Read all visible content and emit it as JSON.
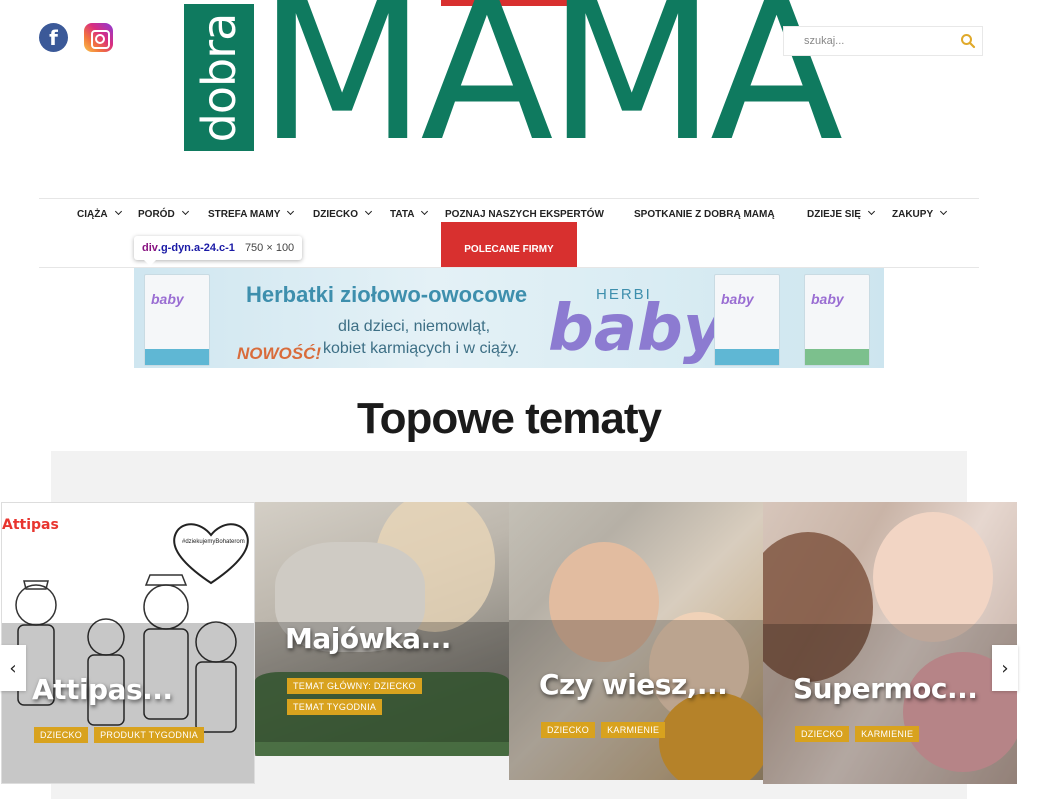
{
  "social": {
    "facebook_icon": "facebook-icon",
    "instagram_icon": "instagram-icon"
  },
  "logo": {
    "prefix": "dobra",
    "main": "MAMA"
  },
  "search": {
    "placeholder": "szukaj...",
    "icon": "search-icon"
  },
  "nav": {
    "items": [
      {
        "label": "CIĄŻA",
        "has_dropdown": true
      },
      {
        "label": "PORÓD",
        "has_dropdown": true
      },
      {
        "label": "STREFA MAMY",
        "has_dropdown": true
      },
      {
        "label": "DZIECKO",
        "has_dropdown": true
      },
      {
        "label": "TATA",
        "has_dropdown": true
      },
      {
        "label": "POZNAJ NASZYCH EKSPERTÓW",
        "has_dropdown": false
      },
      {
        "label": "SPOTKANIE Z DOBRĄ MAMĄ",
        "has_dropdown": false
      },
      {
        "label": "DZIEJE SIĘ",
        "has_dropdown": true
      },
      {
        "label": "ZAKUPY",
        "has_dropdown": true
      }
    ],
    "highlighted": "POLECANE FIRMY",
    "accent_color": "#d8302f"
  },
  "devtools_tooltip": {
    "tag": "div",
    "selector": ".g-dyn.a-24.c-1",
    "size": "750 × 100"
  },
  "banner": {
    "headline": "Herbatki ziołowo-owocowe",
    "line1": "dla dzieci, niemowląt,",
    "line2": "kobiet karmiących i w ciąży.",
    "badge": "NOWOŚĆ!",
    "brand_top": "HERBI",
    "brand_main": "baby",
    "package_label": "baby"
  },
  "section_title": "Topowe tematy",
  "carousel": {
    "prev_icon": "chevron-left-icon",
    "next_icon": "chevron-right-icon",
    "prev": "‹",
    "next": "›",
    "cards": [
      {
        "title": "Attipas...",
        "tags": [
          "DZIECKO",
          "PRODUKT TYGODNIA"
        ],
        "brand": "Attipas",
        "hashtag": "#dziekujemyBohaterom"
      },
      {
        "title": "Majówka...",
        "tags": [
          "TEMAT GŁÓWNY: DZIECKO",
          "TEMAT TYGODNIA"
        ]
      },
      {
        "title": "Czy wiesz,...",
        "tags": [
          "DZIECKO",
          "KARMIENIE"
        ]
      },
      {
        "title": "Supermoc...",
        "tags": [
          "DZIECKO",
          "KARMIENIE"
        ]
      }
    ],
    "tag_color": "#d8a21e"
  },
  "brand_color": "#0f7a5f"
}
